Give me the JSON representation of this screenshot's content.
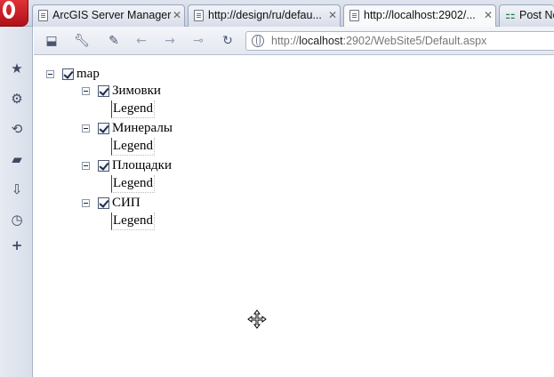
{
  "tabs": [
    {
      "label": "ArcGIS Server Manager",
      "close": "✕"
    },
    {
      "label": "http://design/ru/defau...",
      "close": "✕"
    },
    {
      "label": "http://localhost:2902/...",
      "close": "✕"
    },
    {
      "label": "Post Ne"
    }
  ],
  "address": {
    "prefix": "http://",
    "host": "localhost",
    "rest": ":2902/WebSite5/Default.aspx"
  },
  "tree": {
    "root_label": "map",
    "layers": [
      {
        "label": "Зимовки",
        "legend": "Legend"
      },
      {
        "label": "Минералы",
        "legend": "Legend"
      },
      {
        "label": "Площадки",
        "legend": "Legend"
      },
      {
        "label": "СИП",
        "legend": "Legend"
      }
    ]
  },
  "colors": {
    "opera_red": "#c8141e",
    "chrome_bg": "#dfe4ee"
  },
  "icons": {
    "side": [
      "bookmarks-icon",
      "settings-icon",
      "share-icon",
      "notes-icon",
      "downloads-icon",
      "history-icon",
      "add-panel-icon"
    ],
    "toolbar": [
      "save-icon",
      "wrench-icon",
      "brush-icon",
      "back-icon",
      "forward-icon",
      "key-icon",
      "reload-icon"
    ]
  }
}
